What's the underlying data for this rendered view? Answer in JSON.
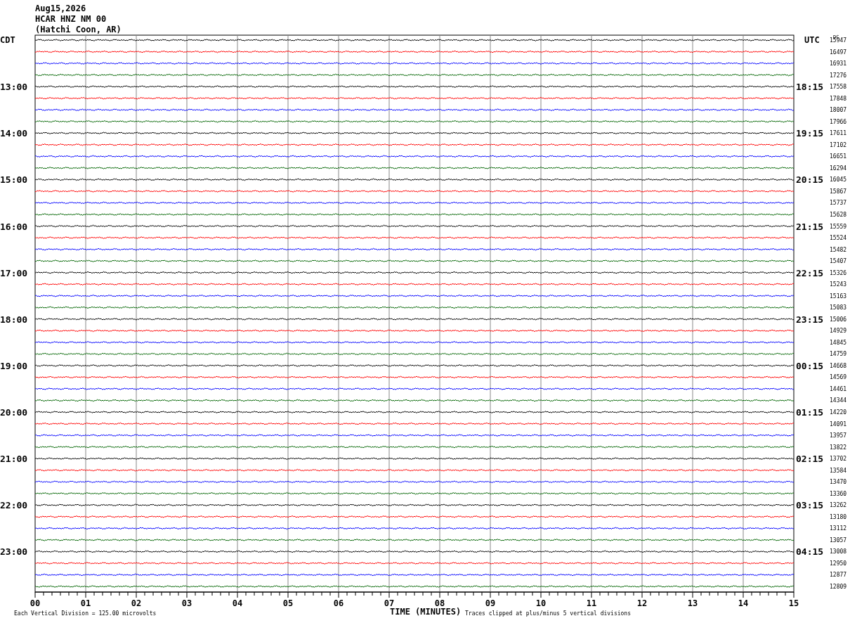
{
  "header": [
    "Aug15,2026",
    "HCAR HNZ NM 00",
    "(Hatchi Coon, AR)"
  ],
  "left_zone": "CDT",
  "right_zone": "UTC",
  "dc_heading": "DC",
  "rows": [
    {
      "color": "#000000",
      "dc": "15947"
    },
    {
      "color": "#ff0000",
      "dc": "16497"
    },
    {
      "color": "#0000ff",
      "dc": "16931"
    },
    {
      "color": "#006400",
      "dc": "17276"
    },
    {
      "color": "#000000",
      "dc": "17558",
      "cdt": "13:00",
      "utc": "18:15"
    },
    {
      "color": "#ff0000",
      "dc": "17848"
    },
    {
      "color": "#0000ff",
      "dc": "18007"
    },
    {
      "color": "#006400",
      "dc": "17966"
    },
    {
      "color": "#000000",
      "dc": "17611",
      "cdt": "14:00",
      "utc": "19:15"
    },
    {
      "color": "#ff0000",
      "dc": "17102"
    },
    {
      "color": "#0000ff",
      "dc": "16651"
    },
    {
      "color": "#006400",
      "dc": "16294"
    },
    {
      "color": "#000000",
      "dc": "16045",
      "cdt": "15:00",
      "utc": "20:15"
    },
    {
      "color": "#ff0000",
      "dc": "15867"
    },
    {
      "color": "#0000ff",
      "dc": "15737"
    },
    {
      "color": "#006400",
      "dc": "15628"
    },
    {
      "color": "#000000",
      "dc": "15559",
      "cdt": "16:00",
      "utc": "21:15"
    },
    {
      "color": "#ff0000",
      "dc": "15524"
    },
    {
      "color": "#0000ff",
      "dc": "15482"
    },
    {
      "color": "#006400",
      "dc": "15407"
    },
    {
      "color": "#000000",
      "dc": "15326",
      "cdt": "17:00",
      "utc": "22:15"
    },
    {
      "color": "#ff0000",
      "dc": "15243"
    },
    {
      "color": "#0000ff",
      "dc": "15163"
    },
    {
      "color": "#006400",
      "dc": "15083"
    },
    {
      "color": "#000000",
      "dc": "15006",
      "cdt": "18:00",
      "utc": "23:15"
    },
    {
      "color": "#ff0000",
      "dc": "14929"
    },
    {
      "color": "#0000ff",
      "dc": "14845"
    },
    {
      "color": "#006400",
      "dc": "14759"
    },
    {
      "color": "#000000",
      "dc": "14668",
      "cdt": "19:00",
      "utc": "00:15"
    },
    {
      "color": "#ff0000",
      "dc": "14569"
    },
    {
      "color": "#0000ff",
      "dc": "14461"
    },
    {
      "color": "#006400",
      "dc": "14344"
    },
    {
      "color": "#000000",
      "dc": "14220",
      "cdt": "20:00",
      "utc": "01:15"
    },
    {
      "color": "#ff0000",
      "dc": "14091"
    },
    {
      "color": "#0000ff",
      "dc": "13957"
    },
    {
      "color": "#006400",
      "dc": "13822"
    },
    {
      "color": "#000000",
      "dc": "13702",
      "cdt": "21:00",
      "utc": "02:15"
    },
    {
      "color": "#ff0000",
      "dc": "13584"
    },
    {
      "color": "#0000ff",
      "dc": "13470"
    },
    {
      "color": "#006400",
      "dc": "13360"
    },
    {
      "color": "#000000",
      "dc": "13262",
      "cdt": "22:00",
      "utc": "03:15"
    },
    {
      "color": "#ff0000",
      "dc": "13180"
    },
    {
      "color": "#0000ff",
      "dc": "13112"
    },
    {
      "color": "#006400",
      "dc": "13057"
    },
    {
      "color": "#000000",
      "dc": "13008",
      "cdt": "23:00",
      "utc": "04:15"
    },
    {
      "color": "#ff0000",
      "dc": "12950"
    },
    {
      "color": "#0000ff",
      "dc": "12877"
    },
    {
      "color": "#006400",
      "dc": "12809"
    }
  ],
  "x_ticks": [
    "00",
    "01",
    "02",
    "03",
    "04",
    "05",
    "06",
    "07",
    "08",
    "09",
    "10",
    "11",
    "12",
    "13",
    "14",
    "15"
  ],
  "x_label": "TIME (MINUTES)",
  "scale_note": "Each Vertical Division =  125.00 microvolts",
  "clip_note": "Traces clipped at plus/minus 5 vertical divisions"
}
